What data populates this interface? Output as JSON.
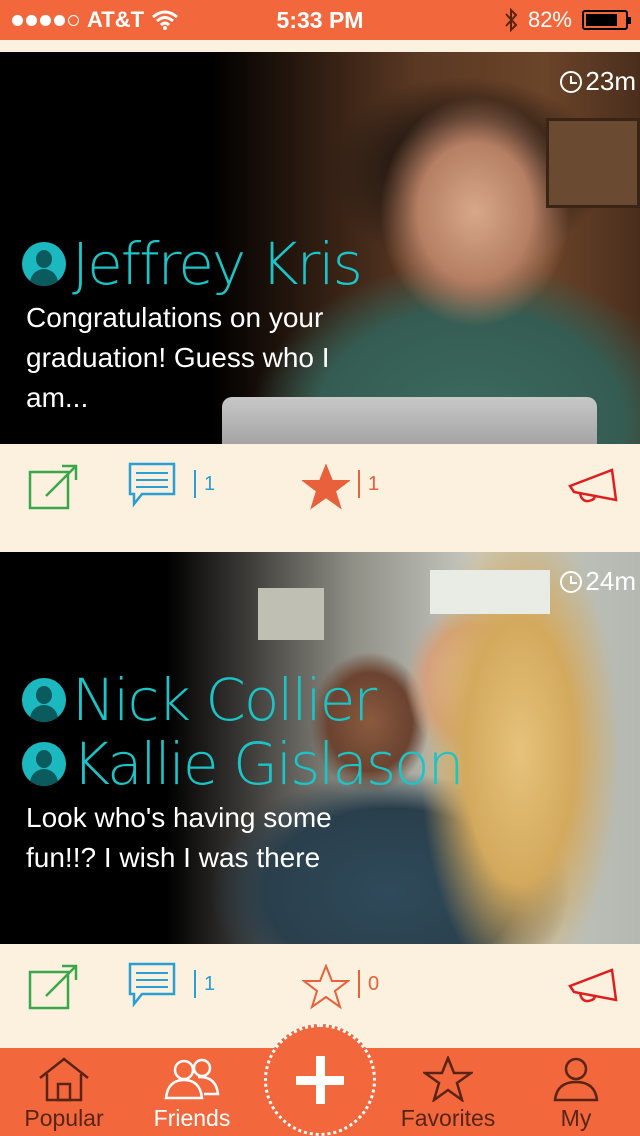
{
  "status_bar": {
    "carrier": "AT&T",
    "time": "5:33 PM",
    "battery": "82%",
    "battery_level": 0.82
  },
  "posts": [
    {
      "timestamp": "23m",
      "names": [
        "Jeffrey Kris"
      ],
      "caption": "Congratulations on your graduation! Guess who I am...",
      "comment_count": "1",
      "favorite_count": "1",
      "favorited": true
    },
    {
      "timestamp": "24m",
      "names": [
        "Nick Collier",
        "Kallie Gislason"
      ],
      "caption": "Look who's having some fun!!? I wish I was there",
      "comment_count": "1",
      "favorite_count": "0",
      "favorited": false
    }
  ],
  "tab_bar": {
    "popular": "Popular",
    "friends": "Friends",
    "favorites": "Favorites",
    "my": "My",
    "active": "friends"
  },
  "colors": {
    "accent": "#f2683c",
    "background": "#fcf1de",
    "name": "#1bc4c7",
    "share": "#3aa84a",
    "comment": "#2a9fd6",
    "star": "#e8603c",
    "megaphone": "#e01e1e"
  },
  "icons": [
    "wifi-icon",
    "bluetooth-icon",
    "clock-icon",
    "person-icon",
    "share-icon",
    "comment-icon",
    "star-icon",
    "megaphone-icon",
    "home-icon",
    "friends-icon",
    "plus-icon",
    "user-icon"
  ]
}
